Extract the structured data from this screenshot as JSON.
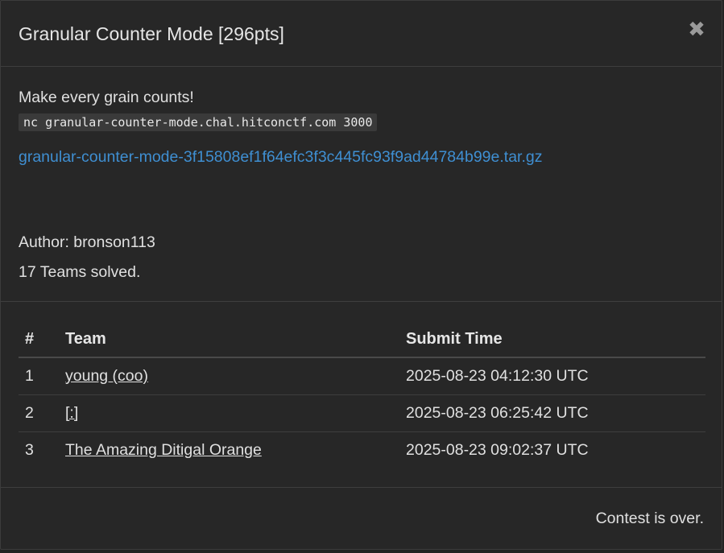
{
  "modal": {
    "title": "Granular Counter Mode [296pts]",
    "close_label": "✖"
  },
  "challenge": {
    "description": "Make every grain counts!",
    "command": "nc granular-counter-mode.chal.hitconctf.com 3000",
    "download_link": "granular-counter-mode-3f15808ef1f64efc3f3c445fc93f9ad44784b99e.tar.gz",
    "author": "Author: bronson113",
    "solved": "17 Teams solved."
  },
  "solves": {
    "headers": {
      "rank": "#",
      "team": "Team",
      "time": "Submit Time"
    },
    "rows": [
      {
        "rank": "1",
        "team": "young (coo)",
        "time": "2025-08-23 04:12:30 UTC"
      },
      {
        "rank": "2",
        "team": "[:]",
        "time": "2025-08-23 06:25:42 UTC"
      },
      {
        "rank": "3",
        "team": "The Amazing Ditigal Orange",
        "time": "2025-08-23 09:02:37 UTC"
      }
    ]
  },
  "footer": {
    "status": "Contest is over."
  }
}
